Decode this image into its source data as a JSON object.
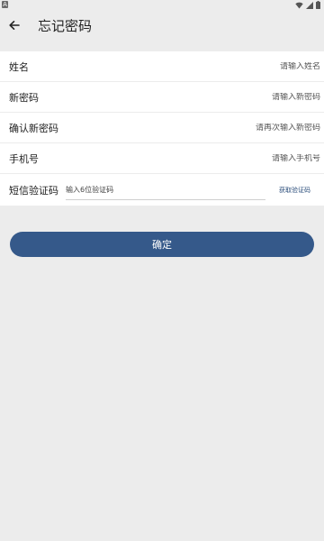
{
  "status_bar": {
    "left_badge": "A",
    "icons": [
      "wifi-icon",
      "signal-icon",
      "battery-icon"
    ]
  },
  "header": {
    "back_icon": "arrow-left-icon",
    "title": "忘记密码"
  },
  "form": {
    "name": {
      "label": "姓名",
      "placeholder": "请输入姓名"
    },
    "new_password": {
      "label": "新密码",
      "placeholder": "请输入新密码"
    },
    "confirm_password": {
      "label": "确认新密码",
      "placeholder": "请再次输入新密码"
    },
    "phone": {
      "label": "手机号",
      "placeholder": "请输入手机号"
    },
    "sms_code": {
      "label": "短信验证码",
      "placeholder": "输入6位验证码",
      "get_code_label": "获取验证码"
    }
  },
  "confirm_button": {
    "label": "确定"
  },
  "colors": {
    "background": "#ececec",
    "card": "#ffffff",
    "primary": "#35598a",
    "link": "#2d4f7c"
  }
}
